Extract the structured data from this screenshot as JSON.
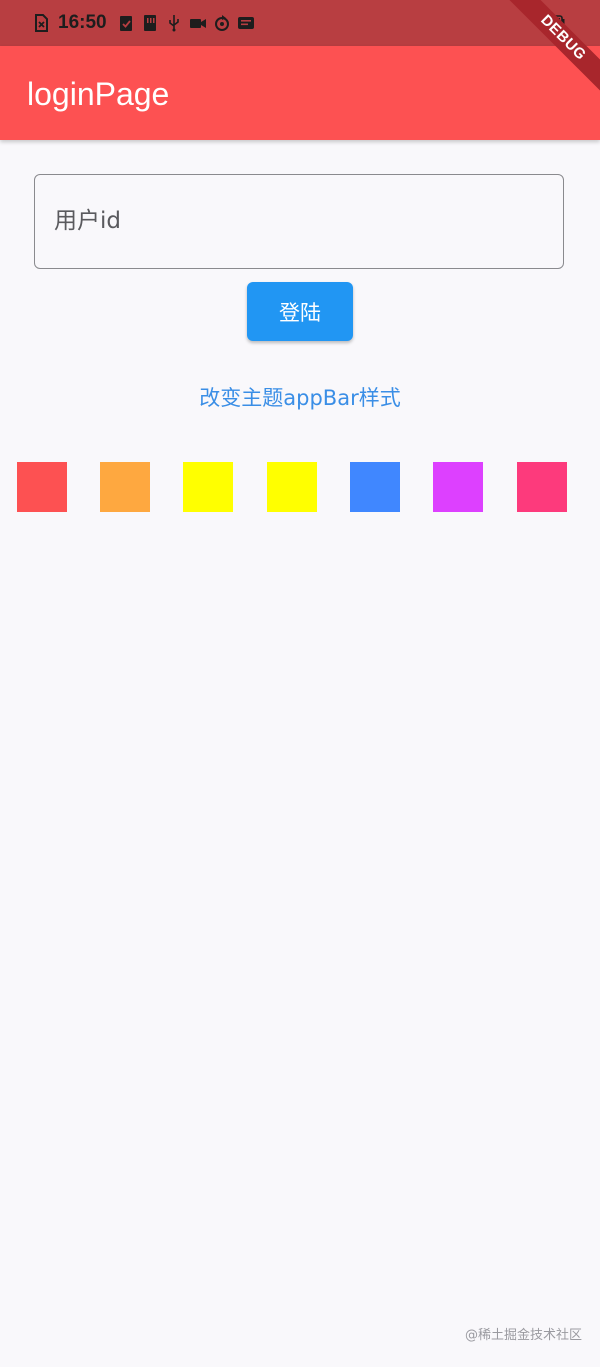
{
  "status_bar": {
    "time": "16:50",
    "background": "#b83e41",
    "icons": [
      "sim-error-icon",
      "check-clipboard-icon",
      "storage-icon",
      "usb-icon",
      "video-icon",
      "sync-icon",
      "message-icon",
      "battery-icon"
    ]
  },
  "app_bar": {
    "title": "loginPage",
    "background": "#fd5152"
  },
  "debug_banner": {
    "label": "DEBUG"
  },
  "login_form": {
    "user_id_placeholder": "用户id",
    "login_button_label": "登陆",
    "button_color": "#2196f3"
  },
  "theme": {
    "change_link_label": "改变主题appBar样式",
    "link_color": "#3a8ee6",
    "swatch_colors": [
      "#fd5152",
      "#fea840",
      "#ffff00",
      "#ffff00",
      "#4087ff",
      "#dd40ff",
      "#fd3a7c"
    ]
  },
  "watermark": "@稀土掘金技术社区"
}
